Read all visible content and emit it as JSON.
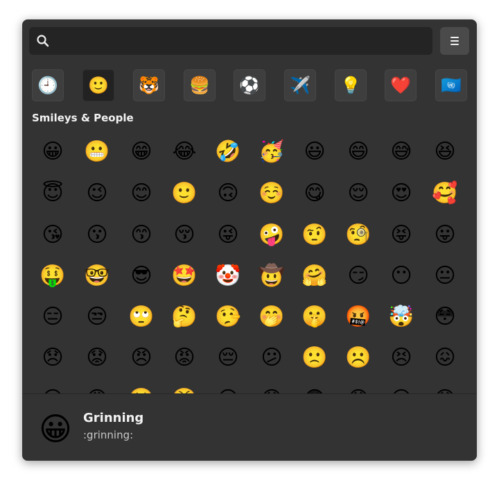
{
  "search": {
    "placeholder": "",
    "value": "",
    "icon": "search-icon"
  },
  "menu_button": {
    "icon": "hamburger-menu-icon"
  },
  "categories": [
    {
      "name": "recent",
      "glyph": "🕘",
      "selected": false
    },
    {
      "name": "smileys-people",
      "glyph": "🙂",
      "selected": true
    },
    {
      "name": "animals-nature",
      "glyph": "🐯",
      "selected": false
    },
    {
      "name": "food-drink",
      "glyph": "🍔",
      "selected": false
    },
    {
      "name": "activities",
      "glyph": "⚽",
      "selected": false
    },
    {
      "name": "travel-places",
      "glyph": "✈️",
      "selected": false
    },
    {
      "name": "objects",
      "glyph": "💡",
      "selected": false
    },
    {
      "name": "symbols",
      "glyph": "❤️",
      "selected": false
    },
    {
      "name": "flags",
      "glyph": "🇺🇳",
      "selected": false
    }
  ],
  "section_title": "Smileys & People",
  "emoji_rows": [
    [
      "😀",
      "😬",
      "😁",
      "😂",
      "🤣",
      "🥳",
      "😃",
      "😄",
      "😅",
      "😆"
    ],
    [
      "😇",
      "😉",
      "😊",
      "🙂",
      "🙃",
      "☺️",
      "😋",
      "😌",
      "😍",
      "🥰"
    ],
    [
      "😘",
      "😗",
      "😙",
      "😚",
      "😜",
      "🤪",
      "🤨",
      "🧐",
      "😝",
      "😛"
    ],
    [
      "🤑",
      "🤓",
      "😎",
      "🤩",
      "🤡",
      "🤠",
      "🤗",
      "😏",
      "😶",
      "😐"
    ],
    [
      "😑",
      "😒",
      "🙄",
      "🤔",
      "🤥",
      "🤭",
      "🤫",
      "🤬",
      "🤯",
      "😳"
    ],
    [
      "😞",
      "😟",
      "😠",
      "😡",
      "😔",
      "😕",
      "🙁",
      "☹️",
      "😣",
      "😖"
    ],
    [
      "😫",
      "😩",
      "🥺",
      "😤",
      "😮",
      "😱",
      "😨",
      "😰",
      "😥",
      "😓"
    ]
  ],
  "footer": {
    "emoji": "😀",
    "name": "Grinning",
    "shortcode": ":grinning:"
  },
  "colors": {
    "window_bg": "#333333",
    "search_bg": "#242424",
    "tile_bg": "#3e3e3e",
    "tile_selected_bg": "#222222",
    "text_primary": "#f2f2f2",
    "text_secondary": "#c8c8c8"
  }
}
